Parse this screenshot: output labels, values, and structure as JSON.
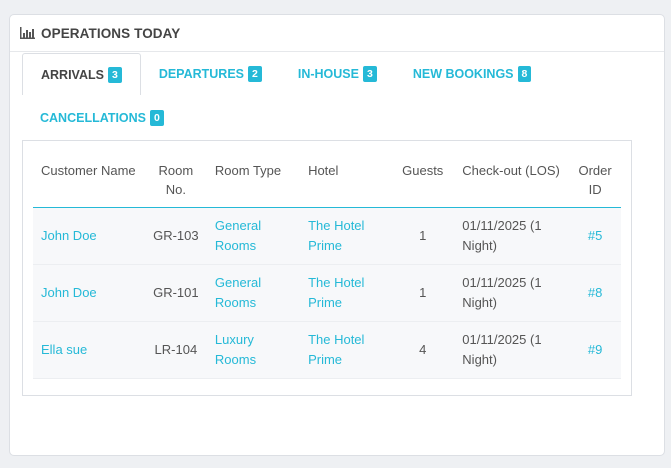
{
  "panel": {
    "title": "OPERATIONS TODAY",
    "icon": "bar-chart-icon"
  },
  "tabs": [
    {
      "label": "ARRIVALS",
      "count": "3",
      "active": true
    },
    {
      "label": "DEPARTURES",
      "count": "2",
      "active": false
    },
    {
      "label": "IN-HOUSE",
      "count": "3",
      "active": false
    },
    {
      "label": "NEW BOOKINGS",
      "count": "8",
      "active": false
    },
    {
      "label": "CANCELLATIONS",
      "count": "0",
      "active": false
    }
  ],
  "table": {
    "headers": {
      "customer": "Customer Name",
      "room_no": "Room No.",
      "room_type": "Room Type",
      "hotel": "Hotel",
      "guests": "Guests",
      "checkout": "Check-out (LOS)",
      "order": "Order ID"
    },
    "rows": [
      {
        "customer": "John Doe",
        "room_no": "GR-103",
        "room_type": "General Rooms",
        "hotel": "The Hotel Prime",
        "guests": "1",
        "checkout": "01/11/2025 (1 Night)",
        "order": "#5"
      },
      {
        "customer": "John Doe",
        "room_no": "GR-101",
        "room_type": "General Rooms",
        "hotel": "The Hotel Prime",
        "guests": "1",
        "checkout": "01/11/2025 (1 Night)",
        "order": "#8"
      },
      {
        "customer": "Ella sue",
        "room_no": "LR-104",
        "room_type": "Luxury Rooms",
        "hotel": "The Hotel Prime",
        "guests": "4",
        "checkout": "01/11/2025 (1 Night)",
        "order": "#9"
      }
    ]
  },
  "colors": {
    "accent": "#25b9d7",
    "text": "#555555"
  }
}
